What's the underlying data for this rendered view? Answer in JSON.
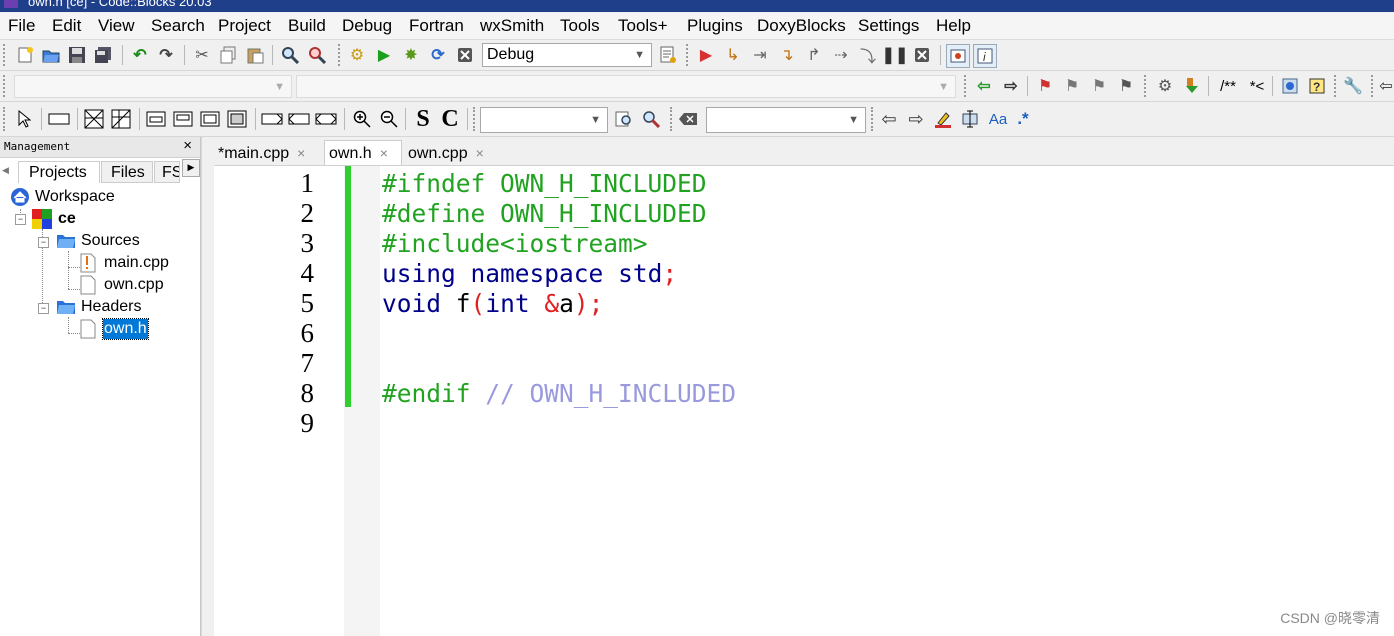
{
  "window": {
    "title": "own.h [ce] - Code::Blocks 20.03"
  },
  "menu": [
    "File",
    "Edit",
    "View",
    "Search",
    "Project",
    "Build",
    "Debug",
    "Fortran",
    "wxSmith",
    "Tools",
    "Tools+",
    "Plugins",
    "DoxyBlocks",
    "Settings",
    "Help"
  ],
  "toolbar": {
    "build_target": "Debug",
    "doxy_comment_a": "/**",
    "doxy_comment_b": "*<",
    "regex_label": ".*",
    "aa_label": "Aa",
    "s_label": "S",
    "c_label": "C"
  },
  "management": {
    "title": "Management",
    "close": "×",
    "tabs": [
      "Projects",
      "Files",
      "FS"
    ],
    "tree": {
      "workspace": "Workspace",
      "project": "ce",
      "sources": "Sources",
      "source_files": [
        "main.cpp",
        "own.cpp"
      ],
      "headers": "Headers",
      "header_files": [
        "own.h"
      ]
    }
  },
  "editor": {
    "tabs": [
      {
        "label": "*main.cpp",
        "active": false
      },
      {
        "label": "own.h",
        "active": true
      },
      {
        "label": "own.cpp",
        "active": false
      }
    ],
    "tab_close": "×",
    "line_numbers": [
      "1",
      "2",
      "3",
      "4",
      "5",
      "6",
      "7",
      "8",
      "9"
    ],
    "code": {
      "l1": "#ifndef OWN_H_INCLUDED",
      "l2": "#define OWN_H_INCLUDED",
      "l3": "#include<iostream>",
      "l4_kw1": "using",
      "l4_kw2": "namespace",
      "l4_kw3": "std",
      "l4_semi": ";",
      "l5_kw1": "void",
      "l5_id1": "f",
      "l5_p1": "(",
      "l5_kw2": "int",
      "l5_amp": "&",
      "l5_id2": "a",
      "l5_p2": ");",
      "l8_pp": "#endif",
      "l8_cm": "// OWN_H_INCLUDED"
    }
  },
  "watermark": "CSDN @晓零清",
  "colors": {
    "preprocessor": "#21a321",
    "keyword": "#00008b",
    "operator": "#e02020",
    "comment": "#9999dd",
    "changebar": "#2ed02e",
    "selection": "#0078d7"
  }
}
